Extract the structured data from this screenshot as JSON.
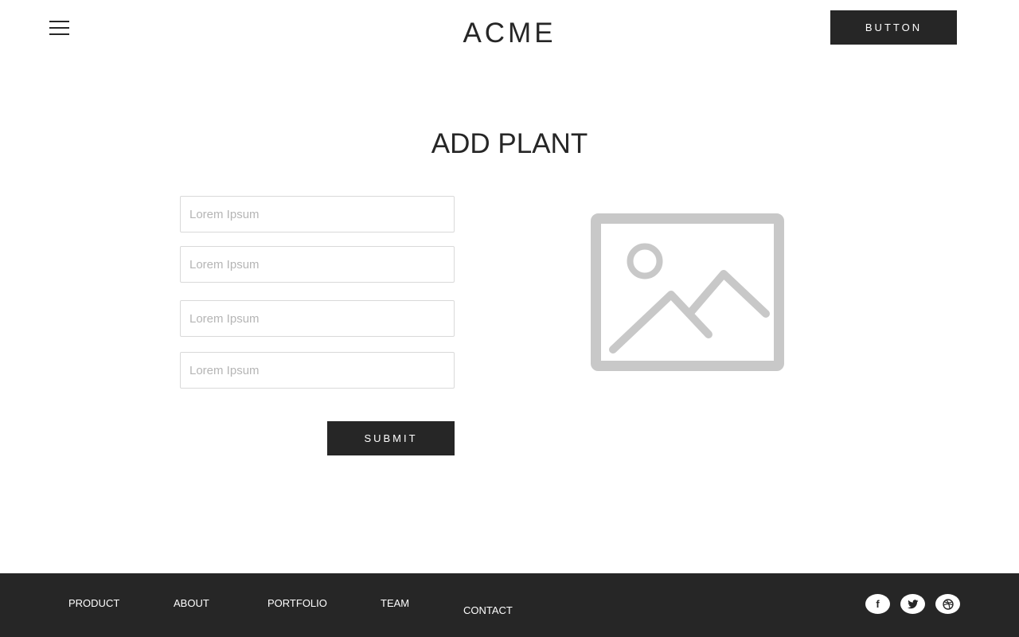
{
  "header": {
    "logo": "ACME",
    "button_label": "BUTTON",
    "menu_icon": "hamburger-menu-icon"
  },
  "main": {
    "title": "ADD PLANT",
    "fields": [
      {
        "placeholder": "Lorem Ipsum",
        "value": ""
      },
      {
        "placeholder": "Lorem Ipsum",
        "value": ""
      },
      {
        "placeholder": "Lorem Ipsum",
        "value": ""
      },
      {
        "placeholder": "Lorem Ipsum",
        "value": ""
      }
    ],
    "submit_label": "SUBMIT",
    "image_icon": "image-placeholder-icon"
  },
  "footer": {
    "links": [
      "PRODUCT",
      "ABOUT",
      "PORTFOLIO",
      "TEAM",
      "CONTACT"
    ],
    "social": [
      {
        "icon": "facebook-icon",
        "glyph": "f"
      },
      {
        "icon": "twitter-icon"
      },
      {
        "icon": "dribbble-icon"
      }
    ]
  },
  "colors": {
    "primary": "#262626",
    "background": "#ffffff",
    "placeholder_text": "#b5b5b5",
    "field_border": "#d9d9d9",
    "image_placeholder": "#c8c8c8"
  }
}
